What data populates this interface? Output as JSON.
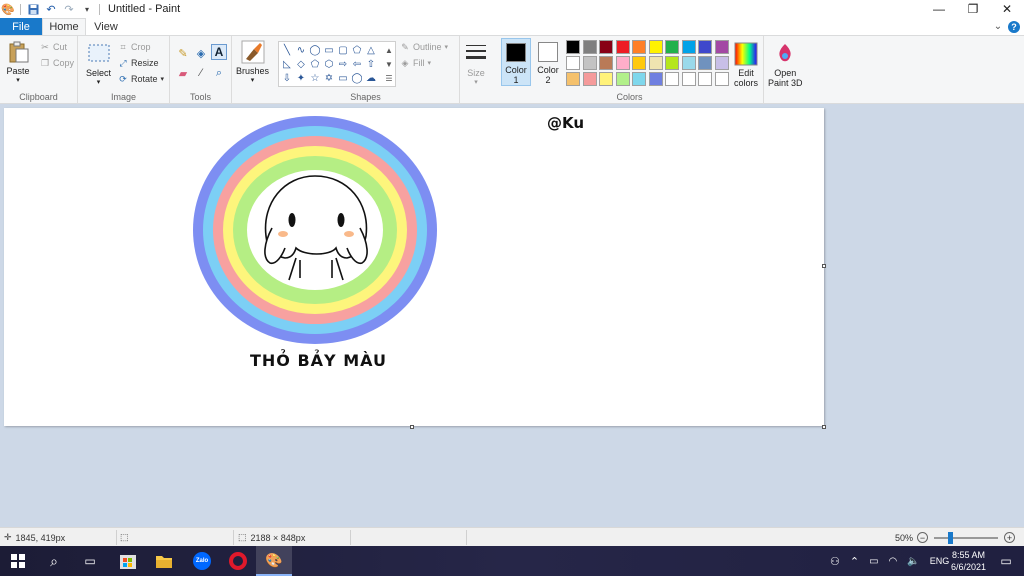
{
  "titlebar": {
    "title": "Untitled - Paint"
  },
  "tabs": {
    "file": "File",
    "home": "Home",
    "view": "View"
  },
  "ribbon": {
    "clipboard": {
      "label": "Clipboard",
      "paste": "Paste",
      "cut": "Cut",
      "copy": "Copy"
    },
    "image": {
      "label": "Image",
      "select": "Select",
      "crop": "Crop",
      "resize": "Resize",
      "rotate": "Rotate"
    },
    "tools": {
      "label": "Tools"
    },
    "brushes": {
      "label": "Brushes"
    },
    "shapes": {
      "label": "Shapes",
      "outline": "Outline",
      "fill": "Fill"
    },
    "size": {
      "label": "Size"
    },
    "colors": {
      "label": "Colors",
      "color1": "Color",
      "color1_num": "1",
      "color2": "Color",
      "color2_num": "2",
      "color1_value": "#000000",
      "color2_value": "#ffffff",
      "edit": "Edit",
      "edit2": "colors",
      "palette_row1": [
        "#000000",
        "#7f7f7f",
        "#880015",
        "#ed1c24",
        "#ff7f27",
        "#fff200",
        "#22b14c",
        "#00a2e8",
        "#3f48cc",
        "#a349a4"
      ],
      "palette_row2": [
        "#ffffff",
        "#c3c3c3",
        "#b97a57",
        "#ffaec9",
        "#ffc90e",
        "#efe4b0",
        "#b5e61d",
        "#99d9ea",
        "#7092be",
        "#c8bfe7"
      ],
      "palette_row3": [
        "#f5c16c",
        "#f59b9b",
        "#fff27a",
        "#b2f08a",
        "#7fd7ec",
        "#6f7fe0",
        "#ffffff",
        "#ffffff",
        "#ffffff",
        "#ffffff"
      ]
    },
    "paint3d": {
      "label1": "Open",
      "label2": "Paint 3D"
    }
  },
  "canvas": {
    "watermark": "@Ku",
    "caption": "THỎ BẢY MÀU",
    "ring_colors": [
      "#7d8ef2",
      "#7ccff5",
      "#f7a1a0",
      "#fdf57c",
      "#b5ee84",
      "#ffffff"
    ]
  },
  "statusbar": {
    "cursor_pos": "1845, 419px",
    "canvas_size": "2188 × 848px",
    "zoom": "50%"
  },
  "taskbar": {
    "time": "8:55 AM",
    "date": "6/6/2021",
    "lang": "ENG"
  }
}
